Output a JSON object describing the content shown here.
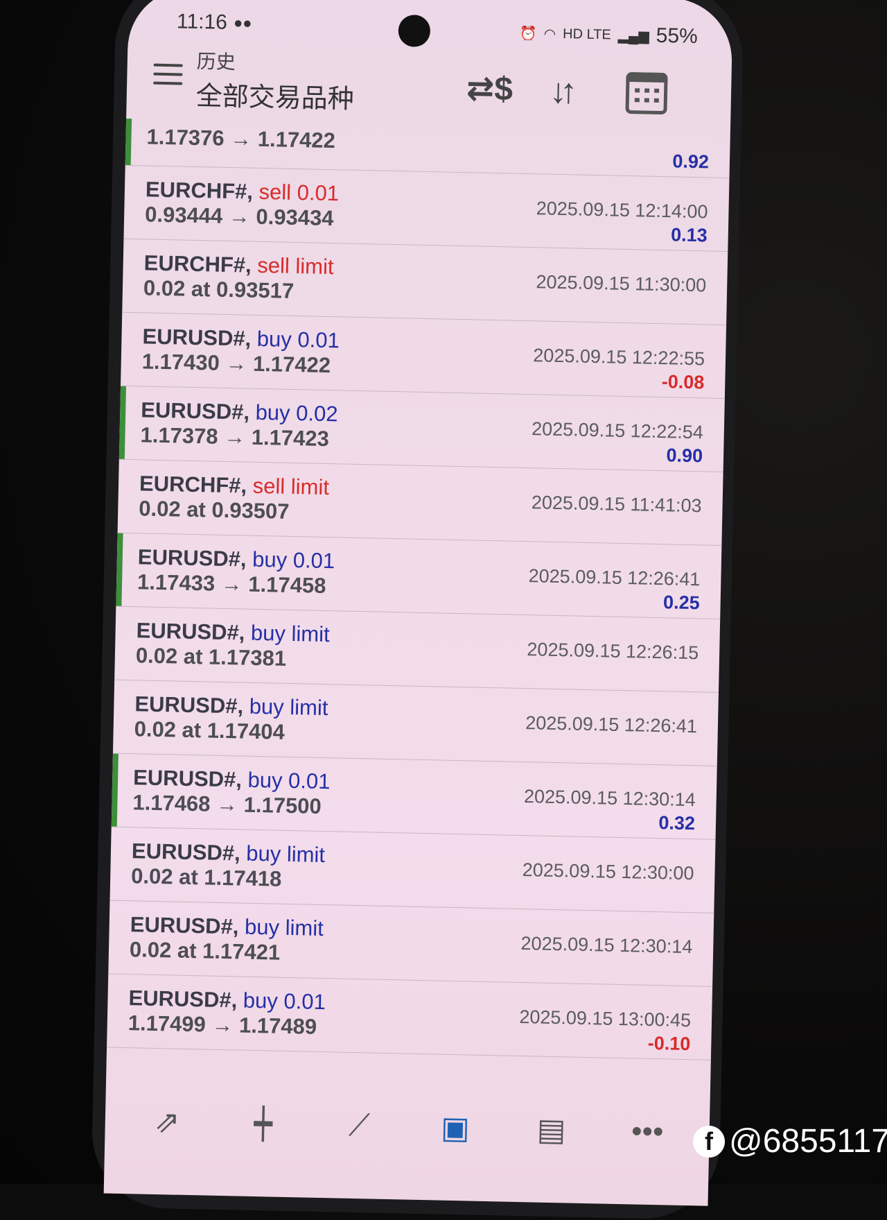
{
  "status_bar": {
    "time": "11:16",
    "signal": "HD LTE",
    "battery": "55%"
  },
  "header": {
    "subtitle": "历史",
    "title": "全部交易品种"
  },
  "icons": {
    "menu": "menu-icon",
    "currency": "dollar-exchange-icon",
    "sort": "sort-icon",
    "calendar": "calendar-icon"
  },
  "colors": {
    "sell": "#d82b2b",
    "buy": "#2530a6",
    "profit_positive": "#2530a6",
    "profit_negative": "#d82b2b",
    "closed_bar": "#3d8f3a"
  },
  "history": [
    {
      "symbol": "",
      "action": "",
      "detail": "1.17376 → 1.17422",
      "time": "",
      "profit": "0.92",
      "bar": true
    },
    {
      "symbol": "EURCHF#, ",
      "action": "sell 0.01",
      "side": "sell",
      "detail": "0.93444 → 0.93434",
      "time": "2025.09.15 12:14:00",
      "profit": "0.13",
      "bar": false
    },
    {
      "symbol": "EURCHF#, ",
      "action": "sell limit",
      "side": "sell",
      "detail": "0.02 at 0.93517",
      "time": "2025.09.15 11:30:00",
      "profit": "",
      "bar": false
    },
    {
      "symbol": "EURUSD#, ",
      "action": "buy 0.01",
      "side": "buy",
      "detail": "1.17430 → 1.17422",
      "time": "2025.09.15 12:22:55",
      "profit": "-0.08",
      "bar": false
    },
    {
      "symbol": "EURUSD#, ",
      "action": "buy 0.02",
      "side": "buy",
      "detail": "1.17378 → 1.17423",
      "time": "2025.09.15 12:22:54",
      "profit": "0.90",
      "bar": true
    },
    {
      "symbol": "EURCHF#, ",
      "action": "sell limit",
      "side": "sell",
      "detail": "0.02 at 0.93507",
      "time": "2025.09.15 11:41:03",
      "profit": "",
      "bar": false
    },
    {
      "symbol": "EURUSD#, ",
      "action": "buy 0.01",
      "side": "buy",
      "detail": "1.17433 → 1.17458",
      "time": "2025.09.15 12:26:41",
      "profit": "0.25",
      "bar": true
    },
    {
      "symbol": "EURUSD#, ",
      "action": "buy limit",
      "side": "buy",
      "detail": "0.02 at 1.17381",
      "time": "2025.09.15 12:26:15",
      "profit": "",
      "bar": false
    },
    {
      "symbol": "EURUSD#, ",
      "action": "buy limit",
      "side": "buy",
      "detail": "0.02 at 1.17404",
      "time": "2025.09.15 12:26:41",
      "profit": "",
      "bar": false
    },
    {
      "symbol": "EURUSD#, ",
      "action": "buy 0.01",
      "side": "buy",
      "detail": "1.17468 → 1.17500",
      "time": "2025.09.15 12:30:14",
      "profit": "0.32",
      "bar": true
    },
    {
      "symbol": "EURUSD#, ",
      "action": "buy limit",
      "side": "buy",
      "detail": "0.02 at 1.17418",
      "time": "2025.09.15 12:30:00",
      "profit": "",
      "bar": false
    },
    {
      "symbol": "EURUSD#, ",
      "action": "buy limit",
      "side": "buy",
      "detail": "0.02 at 1.17421",
      "time": "2025.09.15 12:30:14",
      "profit": "",
      "bar": false
    },
    {
      "symbol": "EURUSD#, ",
      "action": "buy 0.01",
      "side": "buy",
      "detail": "1.17499 → 1.17489",
      "time": "2025.09.15 13:00:45",
      "profit": "-0.10",
      "bar": false
    }
  ],
  "bottom_nav": [
    {
      "icon": "quotes-icon",
      "glyph": "⇗"
    },
    {
      "icon": "chart-icon",
      "glyph": "┿"
    },
    {
      "icon": "trade-icon",
      "glyph": "⟋"
    },
    {
      "icon": "history-icon",
      "glyph": "▣",
      "active": true
    },
    {
      "icon": "news-icon",
      "glyph": "▤"
    },
    {
      "icon": "messages-icon",
      "glyph": "•••"
    }
  ],
  "watermark": {
    "text": "@6855117"
  }
}
